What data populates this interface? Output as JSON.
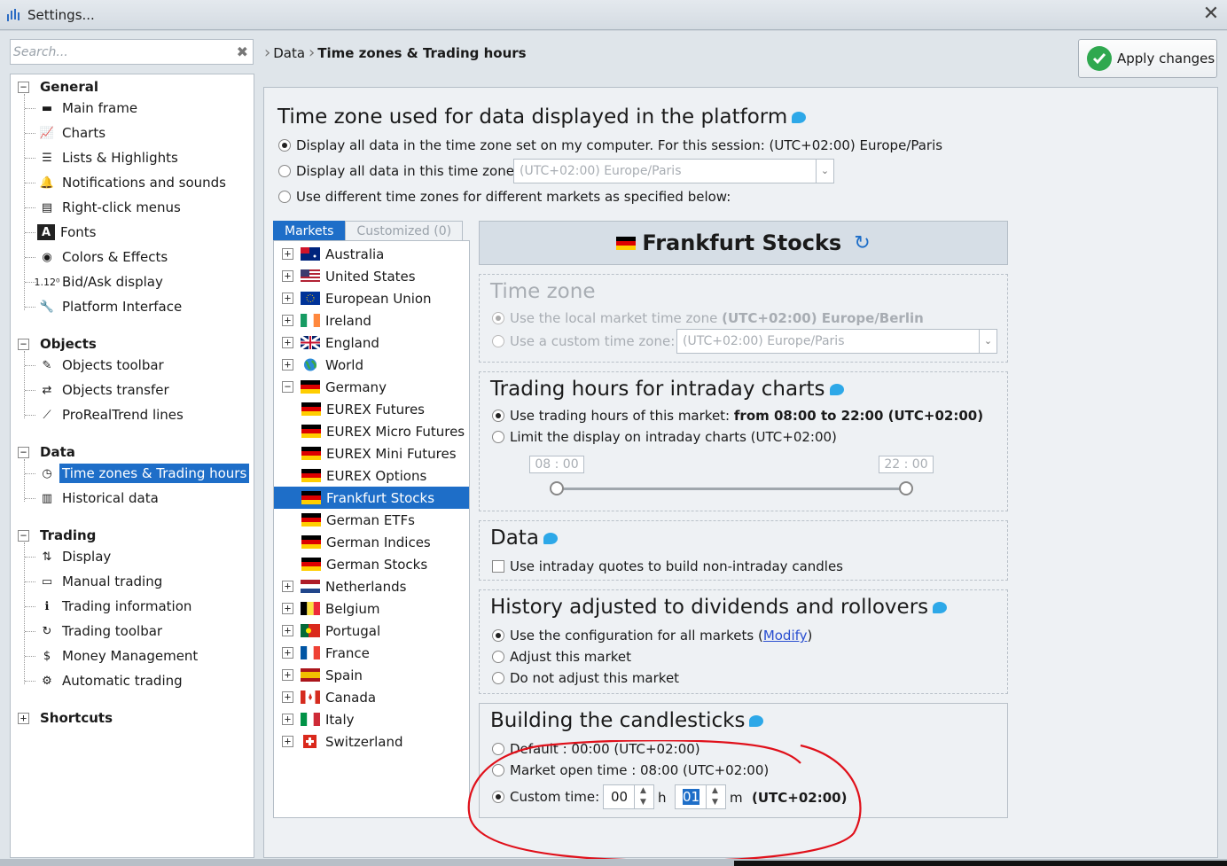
{
  "window": {
    "title": "Settings...",
    "close_icon": "close-icon"
  },
  "search": {
    "placeholder": "Search..."
  },
  "tree": {
    "groups": [
      {
        "label": "General",
        "items": [
          "Main frame",
          "Charts",
          "Lists & Highlights",
          "Notifications and sounds",
          "Right-click menus",
          "Fonts",
          "Colors & Effects",
          "Bid/Ask display",
          "Platform Interface"
        ]
      },
      {
        "label": "Objects",
        "items": [
          "Objects toolbar",
          "Objects transfer",
          "ProRealTrend lines"
        ]
      },
      {
        "label": "Data",
        "items": [
          "Time zones & Trading hours",
          "Historical data"
        ]
      },
      {
        "label": "Trading",
        "items": [
          "Display",
          "Manual trading",
          "Trading information",
          "Trading toolbar",
          "Money Management",
          "Automatic trading"
        ]
      },
      {
        "label": "Shortcuts",
        "items": []
      }
    ],
    "bidask_prefix": "1.12⁰",
    "selected": "Time zones & Trading hours"
  },
  "breadcrumb": {
    "parent": "Data",
    "current": "Time zones & Trading hours"
  },
  "apply_button": {
    "label": "Apply changes"
  },
  "timezone": {
    "heading": "Time zone used for data displayed in the platform",
    "opt_computer": "Display all data in the time zone set on my computer. For this session: (UTC+02:00) Europe/Paris",
    "opt_this": "Display all data in this time zone:",
    "opt_this_value": "(UTC+02:00) Europe/Paris",
    "opt_different": "Use different time zones for different markets as specified below:"
  },
  "market_tabs": {
    "markets": "Markets",
    "customized": "Customized (0)"
  },
  "markets": [
    {
      "name": "Australia",
      "expand": "+"
    },
    {
      "name": "United States",
      "expand": "+"
    },
    {
      "name": "European Union",
      "expand": "+"
    },
    {
      "name": "Ireland",
      "expand": "+"
    },
    {
      "name": "England",
      "expand": "+"
    },
    {
      "name": "World",
      "expand": "+"
    },
    {
      "name": "Germany",
      "expand": "−"
    },
    {
      "name": "EUREX Futures",
      "child": true
    },
    {
      "name": "EUREX Micro Futures",
      "child": true
    },
    {
      "name": "EUREX Mini Futures",
      "child": true
    },
    {
      "name": "EUREX Options",
      "child": true
    },
    {
      "name": "Frankfurt Stocks",
      "child": true,
      "selected": true
    },
    {
      "name": "German ETFs",
      "child": true
    },
    {
      "name": "German Indices",
      "child": true
    },
    {
      "name": "German Stocks",
      "child": true
    },
    {
      "name": "Netherlands",
      "expand": "+"
    },
    {
      "name": "Belgium",
      "expand": "+"
    },
    {
      "name": "Portugal",
      "expand": "+"
    },
    {
      "name": "France",
      "expand": "+"
    },
    {
      "name": "Spain",
      "expand": "+"
    },
    {
      "name": "Canada",
      "expand": "+"
    },
    {
      "name": "Italy",
      "expand": "+"
    },
    {
      "name": "Switzerland",
      "expand": "+"
    }
  ],
  "market_panel": {
    "title": "Frankfurt Stocks",
    "tz_section": {
      "heading": "Time zone",
      "opt_local_prefix": "Use the local market time zone",
      "opt_local_value": "(UTC+02:00) Europe/Berlin",
      "opt_custom": "Use a custom time zone:",
      "opt_custom_value": "(UTC+02:00) Europe/Paris"
    },
    "hours_section": {
      "heading": "Trading hours for intraday charts",
      "opt_market_prefix": "Use trading hours of this market:",
      "opt_market_value": "from 08:00 to 22:00 (UTC+02:00)",
      "opt_limit": "Limit the display on intraday charts (UTC+02:00)",
      "slider_start": "08 : 00",
      "slider_end": "22 : 00"
    },
    "data_section": {
      "heading": "Data",
      "checkbox": "Use intraday quotes to build non-intraday candles"
    },
    "history_section": {
      "heading": "History adjusted to dividends and rollovers",
      "opt_config_prefix": "Use the configuration for all markets (",
      "opt_config_link": "Modify",
      "opt_config_suffix": ")",
      "opt_adjust": "Adjust this market",
      "opt_no_adjust": "Do not adjust this market"
    },
    "candles_section": {
      "heading": "Building the candlesticks",
      "opt_default": "Default : 00:00 (UTC+02:00)",
      "opt_open": "Market open time : 08:00 (UTC+02:00)",
      "opt_custom": "Custom time:",
      "hours_value": "00",
      "hours_unit": "h",
      "minutes_value": "01",
      "minutes_unit": "m",
      "tz_suffix": "(UTC+02:00)"
    }
  },
  "colors": {
    "accent": "#1e6ec8",
    "annotation": "#e0101a",
    "ok": "#2fa84f"
  }
}
